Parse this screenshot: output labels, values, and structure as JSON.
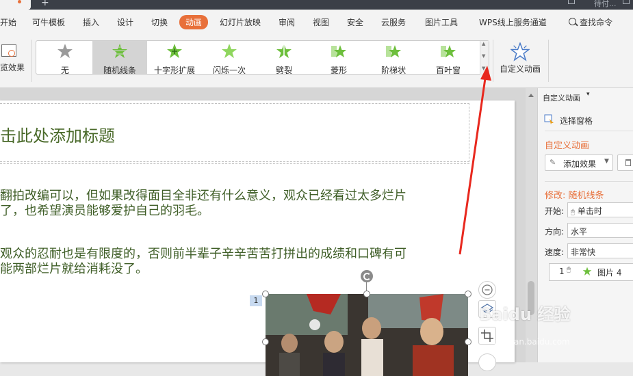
{
  "titlebar": {
    "right_text": "待付..."
  },
  "menu": {
    "items": [
      "开始",
      "可牛模板",
      "插入",
      "设计",
      "切换",
      "动画",
      "幻灯片放映",
      "审阅",
      "视图",
      "安全",
      "云服务",
      "图片工具",
      "WPS线上服务通道"
    ],
    "active": "动画",
    "search_label": "查找命令"
  },
  "ribbon": {
    "preview_label": "览效果",
    "gallery": [
      {
        "label": "无",
        "icon": "star-gray-icon"
      },
      {
        "label": "随机线条",
        "icon": "random-bars-star-icon",
        "selected": true
      },
      {
        "label": "十字形扩展",
        "icon": "plus-star-icon"
      },
      {
        "label": "闪烁一次",
        "icon": "flash-star-icon"
      },
      {
        "label": "劈裂",
        "icon": "split-star-icon"
      },
      {
        "label": "菱形",
        "icon": "diamond-star-icon"
      },
      {
        "label": "阶梯状",
        "icon": "stairs-star-icon"
      },
      {
        "label": "百叶窗",
        "icon": "blinds-star-icon"
      }
    ],
    "custom_animation_label": "自定义动画"
  },
  "slide": {
    "title_placeholder": "击此处添加标题",
    "paragraph1_line1": "翻拍改编可以，但如果改得面目全非还有什么意义，观众已经看过太多烂片",
    "paragraph1_line2": "了，也希望演员能够爱护自己的羽毛。",
    "paragraph2_line1": "观众的忍耐也是有限度的，否则前半辈子辛辛苦苦打拼出的成绩和口碑有可",
    "paragraph2_line2": "能两部烂片就给消耗没了。",
    "image_badge": "1"
  },
  "task_pane": {
    "header": "自定义动画",
    "select_pane": "选择窗格",
    "section_title": "自定义动画",
    "add_effect": "添加效果",
    "modify_label": "修改: 随机线条",
    "start_label": "开始:",
    "start_value": "单击时",
    "direction_label": "方向:",
    "direction_value": "水平",
    "speed_label": "速度:",
    "speed_value": "非常快",
    "list_item": {
      "index": "1",
      "name": "图片 4"
    }
  },
  "watermark": {
    "main": "Baidu 经验",
    "sub": "jingyan.baidu.com"
  },
  "colors": {
    "accent": "#e8703a",
    "star_green": "#6dbf3c",
    "text_green": "#3f5e27",
    "arrow_red": "#e8281e"
  }
}
